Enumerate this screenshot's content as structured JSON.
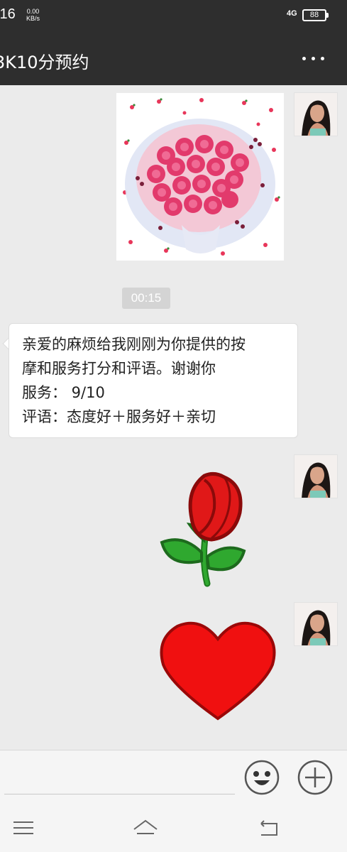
{
  "status_bar": {
    "time": ":16",
    "speed_value": "0.00",
    "speed_unit": "KB/s",
    "network": "4G",
    "battery": "88"
  },
  "header": {
    "title": "3K10分预约",
    "menu_icon": "more-dots-icon"
  },
  "chat": {
    "messages": [
      {
        "side": "right",
        "type": "image",
        "description": "rose bouquet photo"
      },
      {
        "type": "timestamp",
        "text": "00:15"
      },
      {
        "side": "left",
        "type": "text",
        "lines": [
          "亲爱的麻烦给我刚刚为你提供的按",
          "摩和服务打分和评语。谢谢你",
          "服务：  9/10",
          "评语：态度好＋服务好＋亲切"
        ]
      },
      {
        "side": "right",
        "type": "sticker",
        "icon": "red-rose-icon"
      },
      {
        "side": "right",
        "type": "sticker",
        "icon": "red-heart-icon"
      }
    ]
  },
  "input_bar": {
    "input_value": "",
    "emoji_icon": "emoji-smile-icon",
    "plus_icon": "plus-circle-icon"
  },
  "nav_bar": {
    "icons": [
      "menu-icon",
      "home-icon",
      "back-icon"
    ]
  },
  "colors": {
    "header_bg": "#2e2e2e",
    "chat_bg": "#ebebeb",
    "bubble_bg": "#ffffff",
    "timestamp_bg": "#d4d4d4"
  }
}
